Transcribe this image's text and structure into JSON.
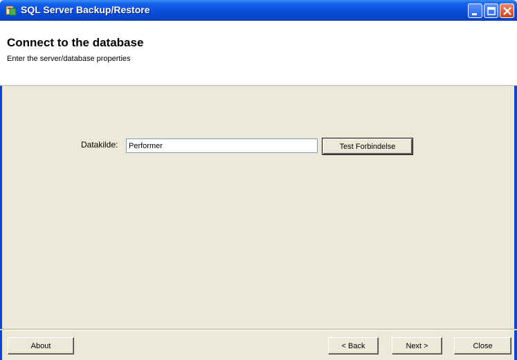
{
  "window": {
    "title": "SQL Server Backup/Restore"
  },
  "header": {
    "title": "Connect to the database",
    "subtitle": "Enter the server/database properties"
  },
  "form": {
    "datasource_label": "Datakilde:",
    "datasource_value": "Performer",
    "test_button_label": "Test Forbindelse"
  },
  "footer": {
    "about_label": "About",
    "back_label": "< Back",
    "next_label": "Next >",
    "close_label": "Close"
  },
  "colors": {
    "titlebar": "#0b4fdc",
    "window_bg": "#ece9d8",
    "close_button": "#c5431f"
  }
}
